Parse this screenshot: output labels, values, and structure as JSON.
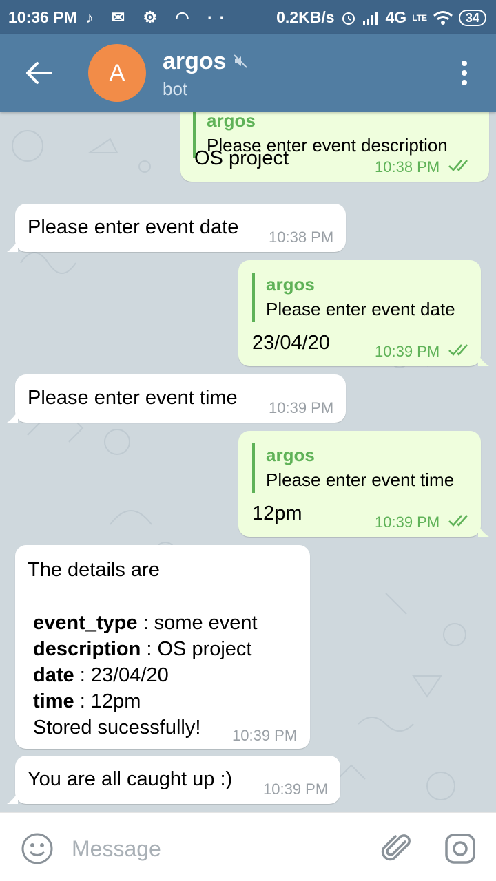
{
  "status_bar": {
    "time": "10:36 PM",
    "icons": "♪ ✉ ⚙ ◠ ··",
    "net_speed": "0.2KB/s",
    "network": "4G",
    "lte": "LTE",
    "battery": "34"
  },
  "header": {
    "avatar_letter": "A",
    "title": "argos",
    "subtitle": "bot",
    "avatar_color": "#f28c48"
  },
  "messages": [
    {
      "dir": "out",
      "reply_to": {
        "name": "argos",
        "text": "Please enter event description"
      },
      "text": "OS project",
      "time": "10:38 PM"
    },
    {
      "dir": "in",
      "text": "Please enter event date",
      "time": "10:38 PM"
    },
    {
      "dir": "out",
      "reply_to": {
        "name": "argos",
        "text": "Please enter event date"
      },
      "text": "23/04/20",
      "time": "10:39 PM"
    },
    {
      "dir": "in",
      "text": "Please enter event time",
      "time": "10:39 PM"
    },
    {
      "dir": "out",
      "reply_to": {
        "name": "argos",
        "text": "Please enter event time"
      },
      "text": "12pm",
      "time": "10:39 PM"
    },
    {
      "dir": "in",
      "intro": "The details are",
      "fields": [
        {
          "key": "event_type",
          "value": " : some event"
        },
        {
          "key": "description",
          "value": " : OS project"
        },
        {
          "key": "date",
          "value": " : 23/04/20"
        },
        {
          "key": "time",
          "value": " : 12pm"
        }
      ],
      "footer": "Stored sucessfully!",
      "time": "10:39 PM"
    },
    {
      "dir": "in",
      "text": "You are all caught up :)",
      "time": "10:39 PM"
    }
  ],
  "input": {
    "placeholder": "Message"
  },
  "colors": {
    "header": "#517da2",
    "status_bar": "#3e6488",
    "outgoing_bubble": "#effedd",
    "accent_green": "#5fb258"
  }
}
